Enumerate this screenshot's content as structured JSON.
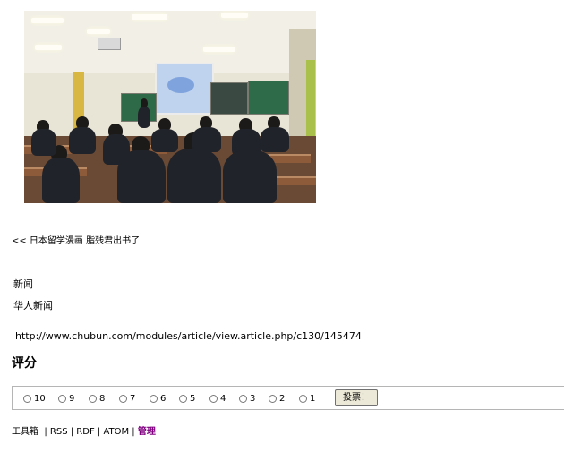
{
  "photo": {
    "alt": "classroom lecture photo"
  },
  "nav": {
    "prev_link": "<< 日本留学漫画 脂残君出书了"
  },
  "tags": {
    "news": "新闻",
    "chinese_news": "华人新闻"
  },
  "source": {
    "url": "http://www.chubun.com/modules/article/view.article.php/c130/145474"
  },
  "rating": {
    "title": "评分",
    "options": [
      "10",
      "9",
      "8",
      "7",
      "6",
      "5",
      "4",
      "3",
      "2",
      "1"
    ],
    "submit_label": "投票！"
  },
  "tools": {
    "label": "工具箱",
    "rss": "RSS",
    "rdf": "RDF",
    "atom": "ATOM",
    "admin": "管理",
    "admin_color": "#800080"
  }
}
